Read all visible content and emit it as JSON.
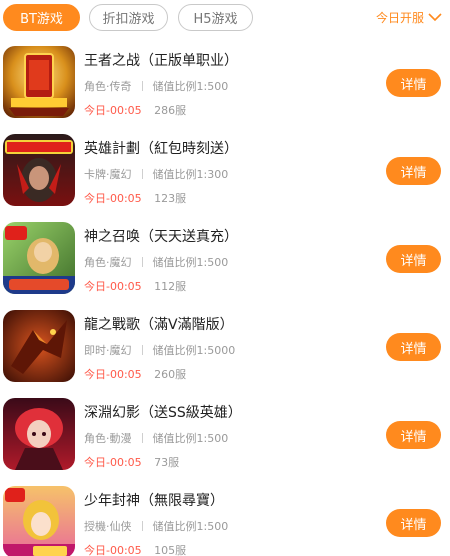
{
  "tabs": {
    "bt": "BT游戏",
    "discount": "折扣游戏",
    "h5": "H5游戏"
  },
  "filter": {
    "label": "今日开服",
    "icon": "chevron-down-icon"
  },
  "colors": {
    "accent": "#ff8a1e",
    "time": "#ff5a4a"
  },
  "games": [
    {
      "name": "王者之战（正版单职业）",
      "genre": "角色·传奇",
      "ratio": "储值比例1:500",
      "time": "今日-00:05",
      "server": "286服",
      "button": "详情"
    },
    {
      "name": "英雄計劃（紅包時刻送）",
      "genre": "卡牌·魔幻",
      "ratio": "储值比例1:300",
      "time": "今日-00:05",
      "server": "123服",
      "button": "详情"
    },
    {
      "name": "神之召唤（天天送真充）",
      "genre": "角色·魔幻",
      "ratio": "储值比例1:500",
      "time": "今日-00:05",
      "server": "112服",
      "button": "详情"
    },
    {
      "name": "龍之戰歌（滿V滿階版）",
      "genre": "即时·魔幻",
      "ratio": "储值比例1:5000",
      "time": "今日-00:05",
      "server": "260服",
      "button": "详情"
    },
    {
      "name": "深淵幻影（送SS級英雄）",
      "genre": "角色·動漫",
      "ratio": "储值比例1:500",
      "time": "今日-00:05",
      "server": "73服",
      "button": "详情"
    },
    {
      "name": "少年封神（無限尋寶）",
      "genre": "授機·仙侠",
      "ratio": "储值比例1:500",
      "time": "今日-00:05",
      "server": "105服",
      "button": "详情"
    }
  ]
}
